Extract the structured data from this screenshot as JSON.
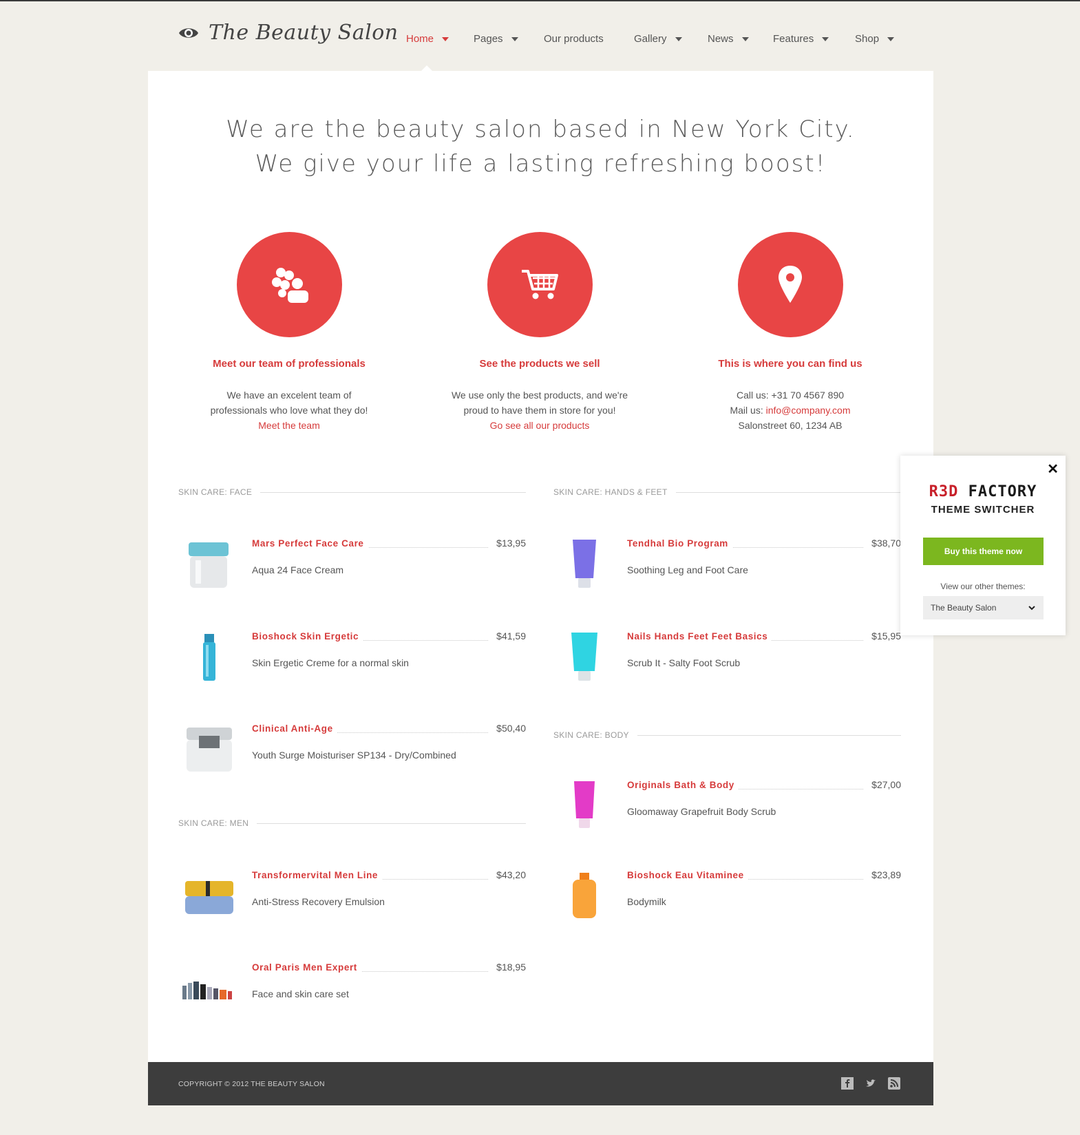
{
  "header": {
    "logo_text": "The Beauty Salon",
    "nav": [
      {
        "label": "Home",
        "has_caret": true,
        "active": true
      },
      {
        "label": "Pages",
        "has_caret": true
      },
      {
        "label": "Our products",
        "has_caret": false
      },
      {
        "label": "Gallery",
        "has_caret": true
      },
      {
        "label": "News",
        "has_caret": true
      },
      {
        "label": "Features",
        "has_caret": true
      },
      {
        "label": "Shop",
        "has_caret": true
      }
    ]
  },
  "hero": {
    "line1": "We are the beauty salon based in New York City.",
    "line2": "We give your life a lasting refreshing boost!"
  },
  "features": [
    {
      "icon": "team-icon",
      "title": "Meet our team of professionals",
      "text1": "We have an excelent team of",
      "text2": "professionals who love what they do!",
      "link": "Meet the team"
    },
    {
      "icon": "cart-icon",
      "title": "See the products we sell",
      "text1": "We use only the best products, and we're",
      "text2": "proud to have them in store for you!",
      "link": "Go see all our products"
    },
    {
      "icon": "location-pin-icon",
      "title": "This is where you can find us",
      "call_label": "Call us: +31 70 4567 890",
      "mail_label": "Mail us:",
      "mail": "info@company.com",
      "address": "Salonstreet 60, 1234 AB"
    }
  ],
  "sections": {
    "face": {
      "title": "SKIN CARE: FACE",
      "items": [
        {
          "name": "Mars Perfect Face Care",
          "price": "$13,95",
          "desc": "Aqua 24 Face Cream"
        },
        {
          "name": "Bioshock Skin Ergetic",
          "price": "$41,59",
          "desc": "Skin Ergetic Creme for a normal skin"
        },
        {
          "name": "Clinical Anti-Age",
          "price": "$50,40",
          "desc": "Youth Surge Moisturiser SP134 - Dry/Combined"
        }
      ]
    },
    "men": {
      "title": "SKIN CARE: MEN",
      "items": [
        {
          "name": "Transformervital Men Line",
          "price": "$43,20",
          "desc": "Anti-Stress Recovery Emulsion"
        },
        {
          "name": "Oral Paris Men Expert",
          "price": "$18,95",
          "desc": "Face and skin care set"
        }
      ]
    },
    "hands": {
      "title": "SKIN CARE: HANDS & FEET",
      "items": [
        {
          "name": "Tendhal Bio Program",
          "price": "$38,70",
          "desc": "Soothing Leg and Foot Care"
        },
        {
          "name": "Nails Hands Feet Feet Basics",
          "price": "$15,95",
          "desc": "Scrub It - Salty Foot Scrub"
        }
      ]
    },
    "body": {
      "title": "SKIN CARE: BODY",
      "items": [
        {
          "name": "Originals Bath & Body",
          "price": "$27,00",
          "desc": "Gloomaway Grapefruit Body Scrub"
        },
        {
          "name": "Bioshock Eau Vitaminee",
          "price": "$23,89",
          "desc": "Bodymilk"
        }
      ]
    }
  },
  "footer": {
    "copyright": "COPYRIGHT © 2012 THE BEAUTY SALON",
    "social": [
      "facebook-icon",
      "twitter-icon",
      "rss-icon"
    ]
  },
  "switcher": {
    "brand_red": "R3D",
    "brand_dark": "FACTORY",
    "subtitle": "THEME SWITCHER",
    "buy_label": "Buy this theme now",
    "view_label": "View our other themes:",
    "selected_theme": "The Beauty Salon"
  },
  "colors": {
    "accent": "#e84545",
    "link": "#d63b3b",
    "buy_button": "#7cb71f",
    "footer": "#3d3d3d",
    "background": "#f1efe9"
  }
}
